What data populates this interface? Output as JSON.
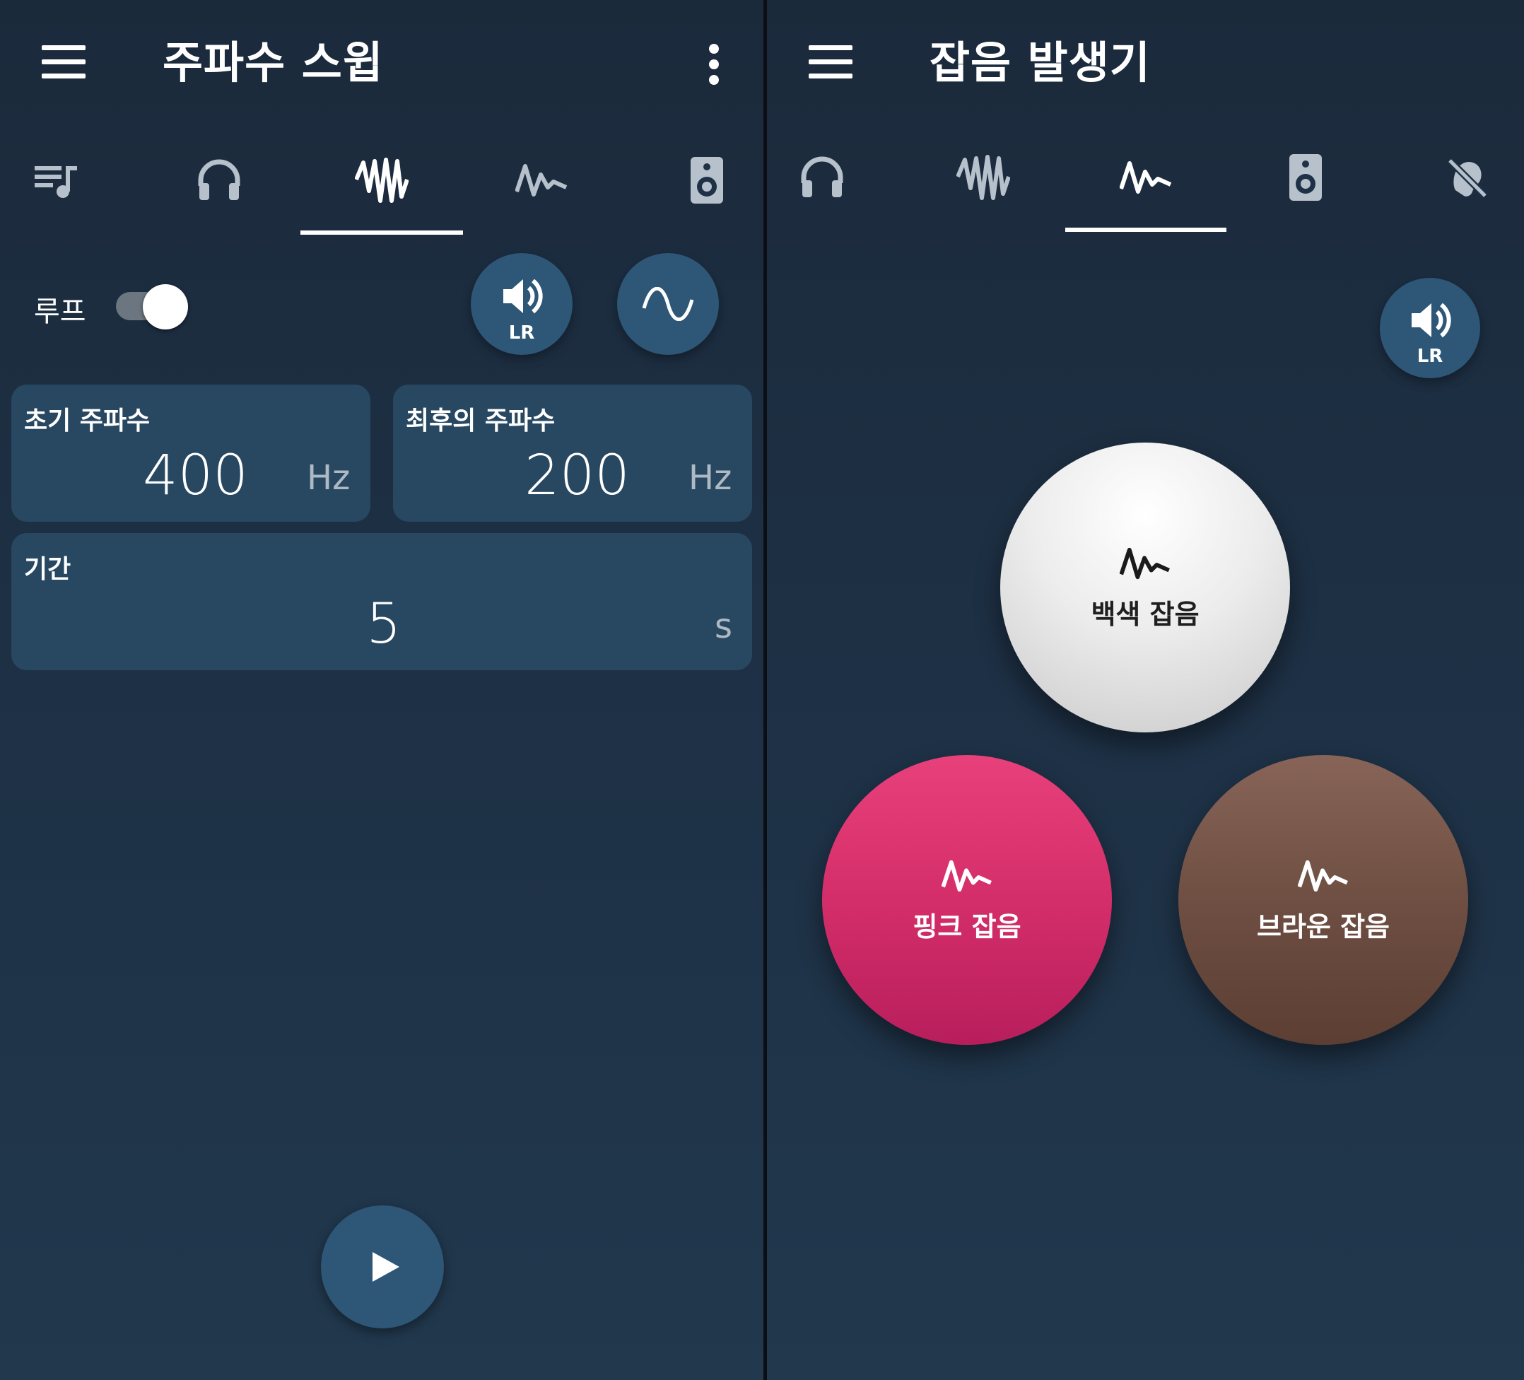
{
  "left": {
    "title": "주파수 스윕",
    "tabs": [
      {
        "icon": "playlist-music-icon",
        "selected": false
      },
      {
        "icon": "headphones-icon",
        "selected": false
      },
      {
        "icon": "sweep-waveform-icon",
        "selected": true
      },
      {
        "icon": "noise-waveform-icon",
        "selected": false
      },
      {
        "icon": "speaker-icon",
        "selected": false
      }
    ],
    "loop_label": "루프",
    "loop_enabled": true,
    "lr_label": "LR",
    "start_freq": {
      "label": "초기 주파수",
      "value": "400",
      "unit": "Hz"
    },
    "end_freq": {
      "label": "최후의 주파수",
      "value": "200",
      "unit": "Hz"
    },
    "duration": {
      "label": "기간",
      "value": "5",
      "unit": "s"
    }
  },
  "right": {
    "title": "잡음 발생기",
    "tabs": [
      {
        "icon": "headphones-icon",
        "selected": false
      },
      {
        "icon": "sweep-waveform-icon",
        "selected": false
      },
      {
        "icon": "noise-waveform-icon",
        "selected": true
      },
      {
        "icon": "speaker-icon",
        "selected": false
      },
      {
        "icon": "hearing-disabled-icon",
        "selected": false
      }
    ],
    "lr_label": "LR",
    "white_noise": "백색 잡음",
    "pink_noise": "핑크 잡음",
    "brown_noise": "브라운 잡음"
  },
  "colors": {
    "background": "#1e3146",
    "button": "#2d5677",
    "card": "#284862",
    "pink": "#d42e6a",
    "brown": "#6d4d41",
    "white": "#f0f0f0"
  }
}
